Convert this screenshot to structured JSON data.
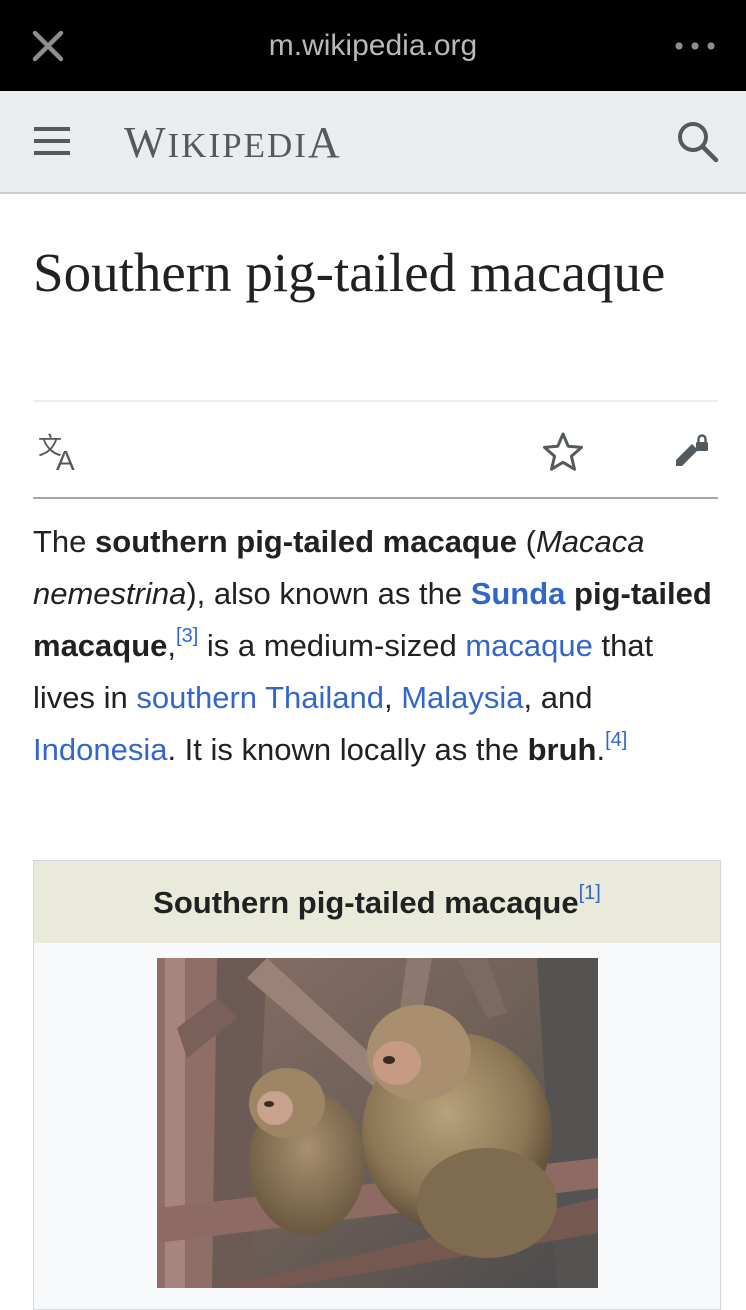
{
  "browser": {
    "url": "m.wikipedia.org"
  },
  "header": {
    "wordmark_first": "W",
    "wordmark_small": "IKIPEDI",
    "wordmark_last": "A"
  },
  "article": {
    "title": "Southern pig-tailed macaque",
    "lead": {
      "t1": "The ",
      "b1": "southern pig-tailed macaque",
      "t2": " (",
      "i1": "Macaca nemestrina",
      "t3": "), also known as the ",
      "link_sunda": "Sunda",
      "t4": " ",
      "b2": "pig-tailed macaque",
      "t5": ",",
      "ref3": "[3]",
      "t6": " is a medium-sized ",
      "link_macaque": "macaque",
      "t7": " that lives in ",
      "link_thailand": "southern Thailand",
      "t8": ", ",
      "link_malaysia": "Malaysia",
      "t9": ", and ",
      "link_indonesia": "Indonesia",
      "t10": ". It is known locally as the ",
      "b3": "bruh",
      "t11": ".",
      "ref4": "[4]"
    }
  },
  "infobox": {
    "caption": "Southern pig-tailed macaque",
    "ref1": "[1]"
  },
  "icons": {
    "close": "close-icon",
    "more": "more-icon",
    "menu": "hamburger-menu-icon",
    "search": "search-icon",
    "language": "language-icon",
    "watch": "star-icon",
    "edit": "edit-lock-icon"
  }
}
